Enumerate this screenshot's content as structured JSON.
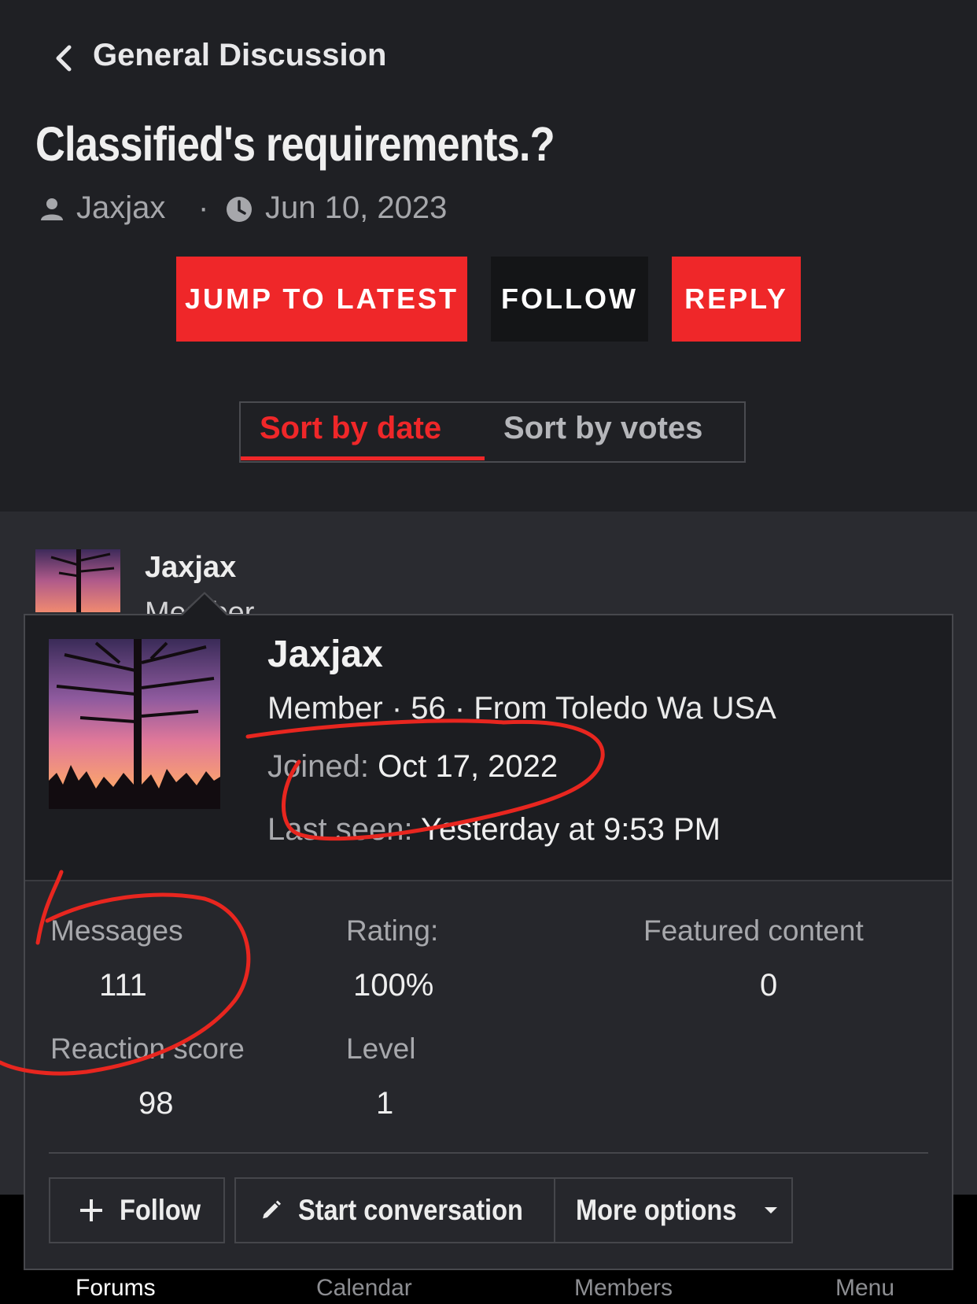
{
  "header": {
    "breadcrumb": "General Discussion",
    "thread_title": "Classified's requirements.?",
    "author": "Jaxjax",
    "separator": "·",
    "date": "Jun 10, 2023"
  },
  "actions": {
    "jump_to_latest": "JUMP TO LATEST",
    "follow": "FOLLOW",
    "reply": "REPLY"
  },
  "sort": {
    "by_date": "Sort by date",
    "by_votes": "Sort by votes",
    "active": "Sort by date"
  },
  "post": {
    "author": "Jaxjax",
    "role": "Member"
  },
  "member_card": {
    "name": "Jaxjax",
    "subtitle": "Member · 56 · From Toledo Wa USA",
    "joined_label": "Joined:",
    "joined_value": "Oct 17, 2022",
    "last_seen_label": "Last seen:",
    "last_seen_value": "Yesterday at 9:53 PM",
    "stats": {
      "messages_label": "Messages",
      "messages_value": "111",
      "rating_label": "Rating:",
      "rating_value": "100%",
      "featured_label": "Featured content",
      "featured_value": "0",
      "reaction_label": "Reaction score",
      "reaction_value": "98",
      "level_label": "Level",
      "level_value": "1"
    },
    "buttons": {
      "follow": "Follow",
      "start_conversation": "Start conversation",
      "more_options": "More options"
    }
  },
  "bottom_nav": {
    "forums": "Forums",
    "calendar": "Calendar",
    "members": "Members",
    "menu": "Menu"
  },
  "colors": {
    "accent": "#ef2729",
    "background": "#1f2024",
    "card": "#26272c",
    "annotation": "#e8261f"
  },
  "icons": [
    "chevron-left-icon",
    "user-icon",
    "clock-icon",
    "plus-icon",
    "pencil-icon",
    "caret-down-icon"
  ]
}
